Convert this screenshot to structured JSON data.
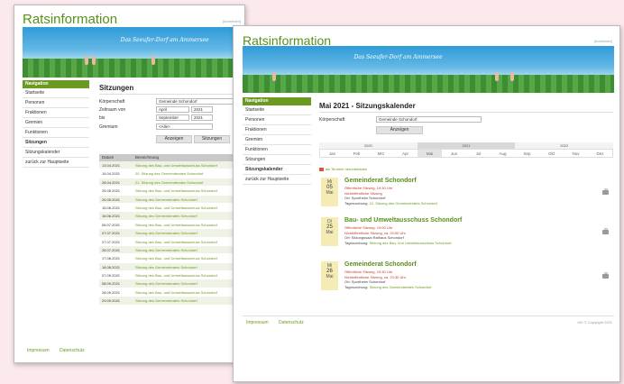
{
  "brand": "Ratsinformation",
  "anmelden": "[Anmelden]",
  "banner_text": "Das Seeufer-Dorf am Ammersee",
  "nav_header": "Navigation",
  "back": {
    "nav": [
      "Startseite",
      "Personen",
      "Fraktionen",
      "Gremien",
      "Funktionen",
      "Sitzungen",
      "Sitzungskalender",
      "zurück zur Hauptseite"
    ],
    "title": "Sitzungen",
    "form": {
      "koerperschaft_label": "Körperschaft",
      "koerperschaft_value": "Gemeinde Schondorf",
      "von_label": "Zeitraum von",
      "von_month": "April",
      "von_year": "2021",
      "bis_label": "bis",
      "bis_month": "September",
      "bis_year": "2021",
      "gremium_label": "Gremium",
      "gremium_value": "<Alle>",
      "btn_anzeigen": "Anzeigen",
      "btn_sitzungen": "Sitzungen"
    },
    "table": {
      "header_datum": "Datum",
      "header_bez": "Bezeichnung",
      "rows": [
        {
          "d": "13.04.2021",
          "b": "Sitzung des Bau- und Umweltausschuss Schondorf"
        },
        {
          "d": "14.04.2021",
          "b": "20. Sitzung des Gemeinderates Schondorf"
        },
        {
          "d": "28.04.2021",
          "b": "21. Sitzung des Gemeinderates Schondorf"
        },
        {
          "d": "25.05.2021",
          "b": "Sitzung des Bau- und Umweltausschuss Schondorf"
        },
        {
          "d": "26.05.2021",
          "b": "Sitzung des Gemeinderates Schondorf"
        },
        {
          "d": "15.06.2021",
          "b": "Sitzung des Bau- und Umweltausschuss Schondorf"
        },
        {
          "d": "16.06.2021",
          "b": "Sitzung des Gemeinderates Schondorf"
        },
        {
          "d": "06.07.2021",
          "b": "Sitzung des Bau- und Umweltausschuss Schondorf"
        },
        {
          "d": "07.07.2021",
          "b": "Sitzung des Gemeinderates Schondorf"
        },
        {
          "d": "27.07.2021",
          "b": "Sitzung des Bau- und Umweltausschuss Schondorf"
        },
        {
          "d": "28.07.2021",
          "b": "Sitzung des Gemeinderates Schondorf"
        },
        {
          "d": "17.08.2021",
          "b": "Sitzung des Bau- und Umweltausschuss Schondorf"
        },
        {
          "d": "18.08.2021",
          "b": "Sitzung des Gemeinderates Schondorf"
        },
        {
          "d": "07.09.2021",
          "b": "Sitzung des Bau- und Umweltausschuss Schondorf"
        },
        {
          "d": "08.09.2021",
          "b": "Sitzung des Gemeinderates Schondorf"
        },
        {
          "d": "28.09.2021",
          "b": "Sitzung des Bau- und Umweltausschuss Schondorf"
        },
        {
          "d": "29.09.2021",
          "b": "Sitzung des Gemeinderates Schondorf"
        }
      ]
    },
    "footer_impressum": "Impressum",
    "footer_datenschutz": "Datenschutz"
  },
  "front": {
    "nav": [
      "Startseite",
      "Personen",
      "Fraktionen",
      "Gremien",
      "Funktionen",
      "Sitzungen",
      "Sitzungskalender",
      "zurück zur Hauptseite"
    ],
    "title": "Mai 2021 - Sitzungskalender",
    "koerperschaft_label": "Körperschaft",
    "koerperschaft_value": "Gemeinde Schondorf",
    "btn_anzeigen": "Anzeigen",
    "years": [
      "2020",
      "2021",
      "2022"
    ],
    "months": [
      "Jan",
      "Feb",
      "Mrz",
      "Apr",
      "Mai",
      "Jun",
      "Jul",
      "Aug",
      "Sep",
      "Okt",
      "Nov",
      "Dez"
    ],
    "legend": "als Termine herunterladen",
    "events": [
      {
        "wd": "Mi",
        "day": "05",
        "mon": "Mai",
        "title": "Gemeinderat Schondorf",
        "l1": "Öffentliche Sitzung, 19:30 Uhr",
        "l2": "Nichtöffentliche Sitzung",
        "l3": "Ort: Sportheim Schondorf",
        "l4_label": "Tagesordnung:",
        "l4_link": "21. Sitzung des Gemeinderates Schondorf"
      },
      {
        "wd": "Di",
        "day": "25",
        "mon": "Mai",
        "title": "Bau- und Umweltausschuss Schondorf",
        "l1": "Öffentliche Sitzung, 19:00 Uhr",
        "l2": "Nichtöffentliche Sitzung, ca. 20:00 Uhr",
        "l3": "Ort: Sitzungssaal Rathaus Schondorf",
        "l4_label": "Tagesordnung:",
        "l4_link": "Sitzung des Bau- und Umweltausschuss Schondorf"
      },
      {
        "wd": "Mi",
        "day": "26",
        "mon": "Mai",
        "title": "Gemeinderat Schondorf",
        "l1": "Öffentliche Sitzung, 19:30 Uhr",
        "l2": "Nichtöffentliche Sitzung, ca. 20:30 Uhr",
        "l3": "Ort: Sportheim Schondorf",
        "l4_label": "Tagesordnung:",
        "l4_link": "Sitzung des Gemeinderates Schondorf"
      }
    ],
    "footer_impressum": "Impressum",
    "footer_datenschutz": "Datenschutz",
    "copyright": "MC © Copyright 2021"
  }
}
